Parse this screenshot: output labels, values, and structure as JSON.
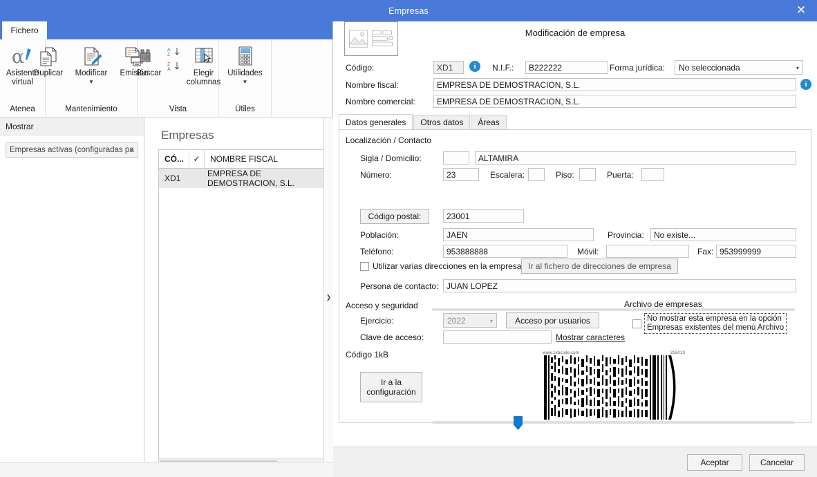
{
  "window": {
    "title": "Empresas",
    "close_label": "✕"
  },
  "ribbon": {
    "tab_label": "Fichero",
    "groups": [
      {
        "label": "Atenea",
        "items": [
          {
            "label": "Asistente\nvirtual",
            "icon": "alpha-assistant-icon",
            "caret": false
          }
        ]
      },
      {
        "label": "Mantenimiento",
        "items": [
          {
            "label": "Duplicar",
            "icon": "duplicate-documents-icon",
            "caret": false
          },
          {
            "label": "Modificar",
            "icon": "edit-document-pencil-icon",
            "caret": true
          },
          {
            "label": "Emisión",
            "icon": "document-printer-icon",
            "caret": false
          }
        ]
      },
      {
        "label": "Vista",
        "items": [
          {
            "label": "Buscar",
            "icon": "binoculars-icon",
            "caret": false
          },
          {
            "label": "Elegir\ncolumnas",
            "icon": "choose-columns-grid-icon",
            "caret": false
          }
        ],
        "sort_icons": [
          "sort-az-icon",
          "sort-za-icon"
        ]
      },
      {
        "label": "Útiles",
        "items": [
          {
            "label": "Utilidades",
            "icon": "calculator-icon",
            "caret": true
          }
        ]
      }
    ]
  },
  "sidebar": {
    "header": "Mostrar",
    "filter_value": "Empresas activas (configuradas pa",
    "filter_arrow": "▾"
  },
  "list": {
    "title": "Empresas",
    "columns": [
      "CÓ...",
      "✓",
      "NOMBRE FISCAL"
    ],
    "rows": [
      {
        "codigo": "XD1",
        "check": "",
        "nombre": "EMPRESA DE DEMOSTRACION, S.L."
      }
    ]
  },
  "collapser": {
    "glyph": "❯"
  },
  "form": {
    "title": "Modificación de empresa",
    "thumb_icon": "image-form-preview-icon",
    "codigo": {
      "label": "Código:",
      "value": "XD1"
    },
    "nif": {
      "label": "N.I.F.:",
      "value": "B222222"
    },
    "forma_juridica": {
      "label": "Forma jurídica:",
      "value": "No seleccionada",
      "arrow": "▾"
    },
    "nombre_fiscal": {
      "label": "Nombre fiscal:",
      "value": "EMPRESA DE DEMOSTRACION, S.L."
    },
    "nombre_comercial": {
      "label": "Nombre comercial:",
      "value": "EMPRESA DE DEMOSTRACION, S.L."
    },
    "tabs": [
      {
        "label": "Datos generales",
        "active": true
      },
      {
        "label": "Otros datos",
        "active": false
      },
      {
        "label": "Áreas",
        "active": false
      }
    ],
    "localizacion": {
      "section": "Localización / Contacto",
      "sigla_domicilio": {
        "label": "Sigla / Domicilio:",
        "sigla": "",
        "domicilio": "ALTAMIRA"
      },
      "numero": {
        "label": "Número:",
        "value": "23"
      },
      "escalera": {
        "label": "Escalera:",
        "value": ""
      },
      "piso": {
        "label": "Piso:",
        "value": ""
      },
      "puerta": {
        "label": "Puerta:",
        "value": ""
      },
      "codigo_postal": {
        "label": "Código postal:",
        "value": "23001"
      },
      "poblacion": {
        "label": "Población:",
        "value": "JAEN"
      },
      "provincia": {
        "label": "Provincia:",
        "value": "No existe..."
      },
      "telefono": {
        "label": "Teléfono:",
        "value": "953888888"
      },
      "movil": {
        "label": "Móvil:",
        "value": ""
      },
      "fax": {
        "label": "Fax:",
        "value": "953999999"
      },
      "varias_direcciones": {
        "label": "Utilizar varias direcciones en la empresa",
        "checked": false
      },
      "ir_fichero_btn": "Ir al fichero de direcciones de empresa",
      "persona_contacto": {
        "label": "Persona de contacto:",
        "value": "JUAN LOPEZ"
      }
    },
    "acceso": {
      "section": "Acceso y seguridad",
      "ejercicio": {
        "label": "Ejercicio:",
        "value": "2022",
        "arrow": "▾"
      },
      "acceso_usuarios_btn": "Acceso por usuarios",
      "clave_acceso": {
        "label": "Clave de acceso:",
        "value": ""
      },
      "mostrar_caracteres_link": "Mostrar caracteres"
    },
    "archivo": {
      "section": "Archivo de empresas",
      "no_mostrar": {
        "line1": "No mostrar esta empresa en la opción",
        "line2": "Empresas existentes del menú Archivo",
        "checked": false
      }
    },
    "codigo_1kb": {
      "label": "Código 1kB",
      "config_btn": "Ir a la\nconfiguración",
      "barcode_site": "www.1kbcode.com",
      "barcode_id": "315013"
    }
  },
  "footer": {
    "accept_label": "Aceptar",
    "cancel_label": "Cancelar"
  },
  "colors": {
    "titlebar": "#4a7ad9",
    "accent_blue": "#0b7ad1",
    "info_blue": "#1e8bd2",
    "row_selected": "#e8e8e8"
  }
}
